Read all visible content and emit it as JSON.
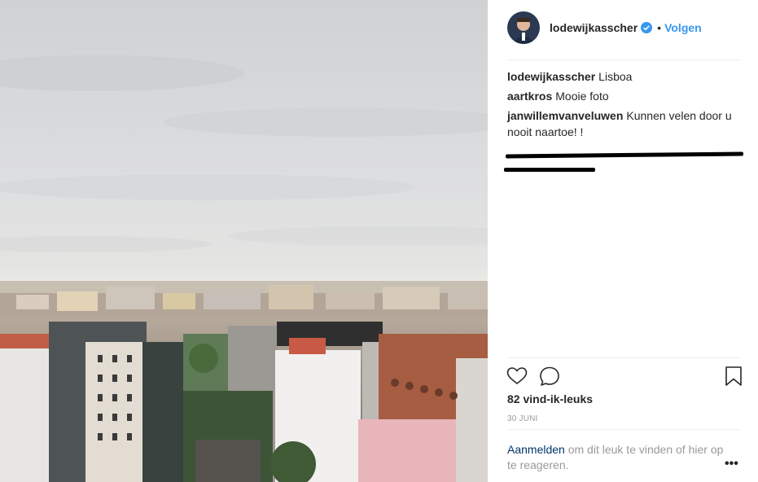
{
  "post": {
    "photo_alt": "Lisboa",
    "author": {
      "username": "lodewijkasscher",
      "verified_icon": "verified-badge-icon",
      "separator": "•",
      "follow_label": "Volgen"
    },
    "comments": [
      {
        "author": "lodewijkasscher",
        "text": "Lisboa"
      },
      {
        "author": "aartkros",
        "text": "Mooie foto"
      },
      {
        "author": "janwillemvanveluwen",
        "text": "Kunnen velen door u nooit naartoe! !"
      }
    ],
    "actions": {
      "like_icon": "heart-icon",
      "comment_icon": "comment-icon",
      "save_icon": "bookmark-icon"
    },
    "likes_label": "82 vind-ik-leuks",
    "date_label": "30 JUNI",
    "login": {
      "link_label": "Aanmelden",
      "rest_label": " om dit leuk te vinden of hier op te reageren."
    },
    "more_label": "•••"
  },
  "colors": {
    "accent": "#3897f0",
    "text": "#262626",
    "muted": "#999999",
    "link_dark": "#003569"
  }
}
